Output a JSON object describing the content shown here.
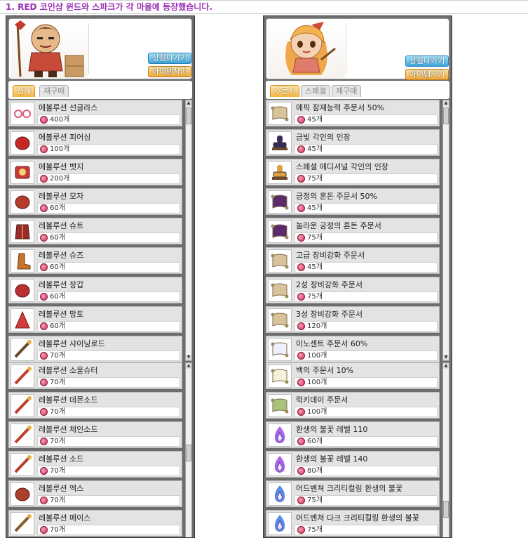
{
  "page": {
    "title": "1. RED 코인샵 윈드와 스파크가 각 마을에 등장했습니다."
  },
  "colors": {
    "title": "#9a2fb5",
    "exit_button": "#3aa6df",
    "buy_button": "#f0a83a",
    "active_tab": "#f2b445"
  },
  "left_shop": {
    "npc": "wind-npc",
    "exit_label": "상점나가기",
    "buy_label": "아이템사기",
    "tabs": [
      {
        "label": "전체",
        "active": true
      },
      {
        "label": "재구매",
        "active": false
      }
    ],
    "list1": [
      {
        "name": "에볼루션 선글라스",
        "price": "400개",
        "icon": "sunglasses-icon"
      },
      {
        "name": "에볼루션 피어싱",
        "price": "100개",
        "icon": "piercing-icon"
      },
      {
        "name": "에볼루션 뱃지",
        "price": "200개",
        "icon": "badge-icon"
      },
      {
        "name": "레볼루션 모자",
        "price": "60개",
        "icon": "hat-icon"
      },
      {
        "name": "레볼루션 슈트",
        "price": "60개",
        "icon": "suit-icon"
      },
      {
        "name": "레볼루션 슈즈",
        "price": "60개",
        "icon": "shoes-icon"
      },
      {
        "name": "레볼루션 장갑",
        "price": "60개",
        "icon": "gloves-icon"
      },
      {
        "name": "레볼루션 망토",
        "price": "60개",
        "icon": "cape-icon"
      },
      {
        "name": "레볼루션 샤이닝로드",
        "price": "70개",
        "icon": "staff-icon"
      }
    ],
    "list2": [
      {
        "name": "레볼루션 소울슈터",
        "price": "70개",
        "icon": "soul-shooter-icon"
      },
      {
        "name": "레볼루션 데몬소드",
        "price": "70개",
        "icon": "demon-sword-icon"
      },
      {
        "name": "레볼루션 체인소드",
        "price": "70개",
        "icon": "chain-sword-icon"
      },
      {
        "name": "레볼루션 소드",
        "price": "70개",
        "icon": "sword-icon"
      },
      {
        "name": "레볼루션 엑스",
        "price": "70개",
        "icon": "axe-icon"
      },
      {
        "name": "레볼루션 메이스",
        "price": "70개",
        "icon": "mace-icon"
      }
    ]
  },
  "right_shop": {
    "npc": "spark-npc",
    "exit_label": "상점나가기",
    "buy_label": "아이템사기",
    "tabs": [
      {
        "label": "주문서",
        "active": true
      },
      {
        "label": "스페셜",
        "active": false
      },
      {
        "label": "재구매",
        "active": false
      }
    ],
    "list1": [
      {
        "name": "에픽 잠재능력 주문서 50%",
        "price": "45개",
        "icon": "scroll-icon"
      },
      {
        "name": "금빛 각인의 인장",
        "price": "45개",
        "icon": "golden-stamp-icon"
      },
      {
        "name": "스페셜 에디셔널 각인의 인장",
        "price": "75개",
        "icon": "stamp-icon"
      },
      {
        "name": "긍정의 혼돈 주문서 50%",
        "price": "45개",
        "icon": "chaos-scroll-icon"
      },
      {
        "name": "놀라운 긍정의 혼돈 주문서",
        "price": "75개",
        "icon": "chaos-scroll-icon"
      },
      {
        "name": "고급 장비강화 주문서",
        "price": "45개",
        "icon": "scroll-icon"
      },
      {
        "name": "2성 장비강화 주문서",
        "price": "75개",
        "icon": "scroll-icon"
      },
      {
        "name": "3성 장비강화 주문서",
        "price": "120개",
        "icon": "scroll-icon"
      },
      {
        "name": "이노센트 주문서 60%",
        "price": "100개",
        "icon": "innocent-scroll-icon"
      }
    ],
    "list2": [
      {
        "name": "백의 주문서 10%",
        "price": "100개",
        "icon": "clean-slate-scroll-icon"
      },
      {
        "name": "럭키데이 주문서",
        "price": "100개",
        "icon": "lucky-day-scroll-icon"
      },
      {
        "name": "환생의 불꽃 레벨 110",
        "price": "60개",
        "icon": "rebirth-flame-icon"
      },
      {
        "name": "환생의 불꽃 레벨 140",
        "price": "80개",
        "icon": "rebirth-flame-icon"
      },
      {
        "name": "어드벤쳐 크리티컬링 환생의 불꽃",
        "price": "75개",
        "icon": "blue-flame-icon"
      },
      {
        "name": "어드벤쳐 다크 크리티컬링 환생의 불꽃",
        "price": "75개",
        "icon": "blue-flame-icon"
      }
    ]
  }
}
